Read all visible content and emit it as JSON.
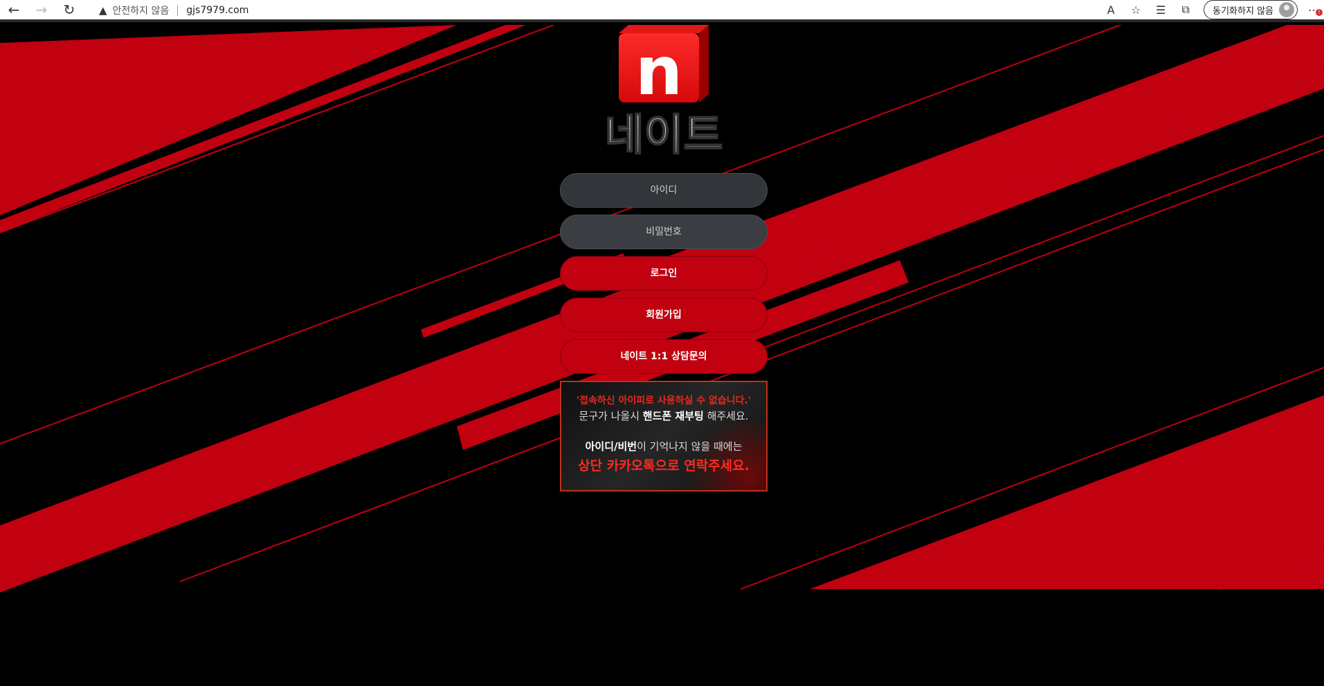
{
  "browser": {
    "security_label": "안전하지 않음",
    "url": "gjs7979.com",
    "sync_label": "동기화하지 않음",
    "notification_badge": "!"
  },
  "logo": {
    "letter": "n",
    "name": "네이트"
  },
  "login": {
    "id_placeholder": "아이디",
    "password_placeholder": "비밀번호",
    "login_label": "로그인",
    "signup_label": "회원가입",
    "consult_label": "네이트 1:1 상담문의"
  },
  "notice": {
    "line1": "'접속하신 아이피로 사용하실 수 없습니다.'",
    "line2_pre": "문구가 나올시 ",
    "line2_bold": "핸드폰 재부팅",
    "line2_post": " 해주세요.",
    "line3_bold": "아이디/비번",
    "line3_post": "이 기억나지 않을 때에는",
    "line4": "상단 카카오톡으로 연락주세요."
  },
  "colors": {
    "accent_red": "#c10010",
    "background": "#000000",
    "input_bg": "#323539"
  }
}
